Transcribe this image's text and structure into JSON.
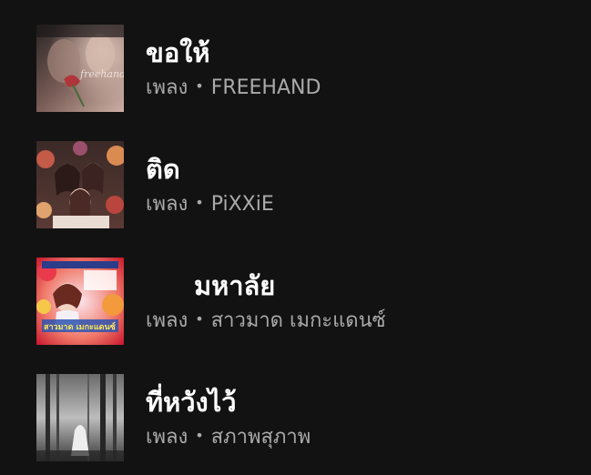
{
  "results": [
    {
      "title": "ขอให้",
      "type_label": "เพลง",
      "separator": "•",
      "artist": "FREEHAND",
      "thumbnail_text": "freehand",
      "thumbnail_colors": [
        "#3b2f2e",
        "#8a6a64",
        "#c9a89b"
      ]
    },
    {
      "title": "ติด",
      "type_label": "เพลง",
      "separator": "•",
      "artist": "PiXXiE",
      "thumbnail_colors": [
        "#3a2320",
        "#b5584a",
        "#e6b6a0"
      ]
    },
    {
      "title": "มหาลัย",
      "type_label": "เพลง",
      "separator": "•",
      "artist": "สาวมาด เมกะแดนซ์",
      "thumbnail_text": "สาวมาด เมกะแดนซ์",
      "thumbnail_colors": [
        "#e7e4f2",
        "#d22a3b",
        "#f6a54b"
      ]
    },
    {
      "title": "ที่หวังไว้",
      "type_label": "เพลง",
      "separator": "•",
      "artist": "สภาพสุภาพ",
      "thumbnail_colors": [
        "#2e2e2e",
        "#7a7a7a",
        "#c8c8c8"
      ]
    }
  ]
}
